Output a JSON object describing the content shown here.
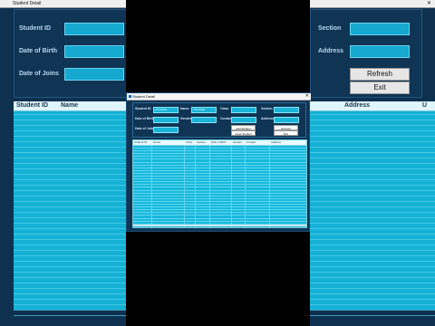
{
  "app_title": "Student Detail",
  "background": {
    "title": "Student Detail",
    "labels_left": [
      "Student ID",
      "Date of Birth",
      "Date of Joins"
    ],
    "labels_right": [
      "Section",
      "Address"
    ],
    "button_refresh": "Refresh",
    "button_exit": "Exit",
    "grid_left_columns": [
      "Student ID",
      "Name"
    ],
    "grid_right_columns": [
      "Address",
      "U"
    ]
  },
  "form": {
    "labels": {
      "student_id": "Student ID",
      "date_of_birth": "Date of Birth",
      "date_of_joins": "Date of Joins",
      "name": "Name",
      "gender": "Gender",
      "class": "Class",
      "contact": "Contact",
      "section": "Section",
      "address": "Address"
    },
    "values": {
      "student_id": "7/17/2023",
      "name": "7/11/2023"
    },
    "buttons": {
      "add_student": "Add Student",
      "clear_student": "Clear Student",
      "refresh": "Refresh",
      "exit": "Exit"
    }
  },
  "table": {
    "columns": [
      "Student ID",
      "Name",
      "Class",
      "Section",
      "Date of Birth",
      "Gender",
      "Contact",
      "Address"
    ],
    "row_count": 28
  }
}
